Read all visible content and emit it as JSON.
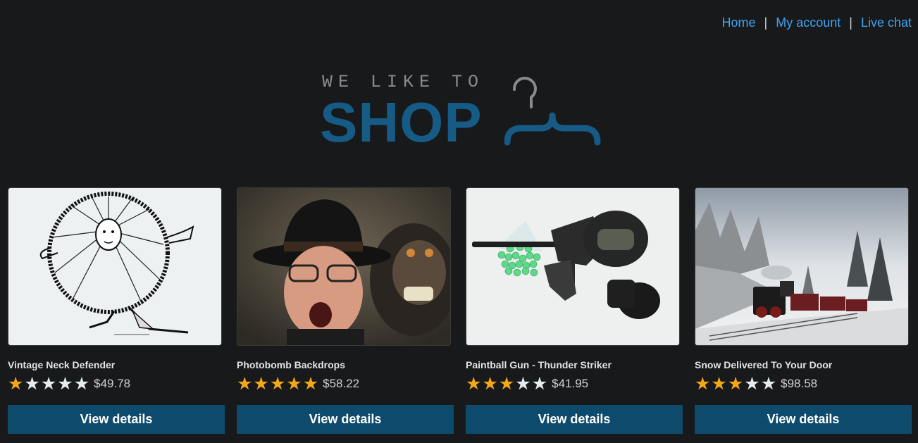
{
  "nav": {
    "home": "Home",
    "account": "My account",
    "chat": "Live chat",
    "separator": "|"
  },
  "logo": {
    "tagline": "WE LIKE TO",
    "word": "SHOP"
  },
  "colors": {
    "background": "#18191b",
    "link": "#3fa3ef",
    "brand": "#155b85",
    "button": "#0e4a6b",
    "star_on": "#f3a817",
    "star_off": "#e4ecef"
  },
  "products": [
    {
      "name": "Vintage Neck Defender",
      "rating": 1,
      "max_rating": 5,
      "price": "$49.78",
      "button": "View details"
    },
    {
      "name": "Photobomb Backdrops",
      "rating": 5,
      "max_rating": 5,
      "price": "$58.22",
      "button": "View details"
    },
    {
      "name": "Paintball Gun - Thunder Striker",
      "rating": 3,
      "max_rating": 5,
      "price": "$41.95",
      "button": "View details"
    },
    {
      "name": "Snow Delivered To Your Door",
      "rating": 3,
      "max_rating": 5,
      "price": "$98.58",
      "button": "View details"
    }
  ]
}
